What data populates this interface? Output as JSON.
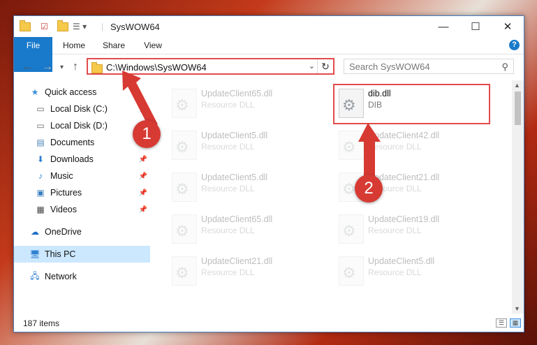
{
  "window": {
    "title": "SysWOW64"
  },
  "ribbon": {
    "tabs": [
      "File",
      "Home",
      "Share",
      "View"
    ],
    "help": "?"
  },
  "address": {
    "path": "C:\\Windows\\SysWOW64"
  },
  "search": {
    "placeholder": "Search SysWOW64"
  },
  "nav": {
    "items": [
      {
        "label": "Quick access",
        "icon": "star-icon"
      },
      {
        "label": "Local Disk (C:)",
        "icon": "drive-icon",
        "pinned": true
      },
      {
        "label": "Local Disk (D:)",
        "icon": "drive-icon"
      },
      {
        "label": "Documents",
        "icon": "document-icon",
        "pinned": true
      },
      {
        "label": "Downloads",
        "icon": "download-icon",
        "pinned": true
      },
      {
        "label": "Music",
        "icon": "music-icon",
        "pinned": true
      },
      {
        "label": "Pictures",
        "icon": "picture-icon",
        "pinned": true
      },
      {
        "label": "Videos",
        "icon": "video-icon",
        "pinned": true
      },
      {
        "label": "OneDrive",
        "icon": "cloud-icon"
      },
      {
        "label": "This PC",
        "icon": "computer-icon",
        "selected": true
      },
      {
        "label": "Network",
        "icon": "network-icon"
      }
    ]
  },
  "files": [
    {
      "name": "UpdateClient65.dll",
      "type": "Resource DLL"
    },
    {
      "name": "dib.dll",
      "type": "DIB"
    },
    {
      "name": "UpdateClient5.dll",
      "type": "Resource DLL"
    },
    {
      "name": "UpdateClient42.dll",
      "type": "Resource DLL"
    },
    {
      "name": "UpdateClient5.dll",
      "type": "Resource DLL"
    },
    {
      "name": "UpdateClient21.dll",
      "type": "Resource DLL"
    },
    {
      "name": "UpdateClient65.dll",
      "type": "Resource DLL"
    },
    {
      "name": "UpdateClient19.dll",
      "type": "Resource DLL"
    },
    {
      "name": "UpdateClient21.dll",
      "type": "Resource DLL"
    },
    {
      "name": "UpdateClient5.dll",
      "type": "Resource DLL"
    }
  ],
  "status": {
    "items": "187 items"
  },
  "annotations": {
    "step1": "1",
    "step2": "2"
  },
  "colors": {
    "accent": "#1979ca",
    "highlight": "#e24b4b",
    "badge": "#d73a33"
  }
}
